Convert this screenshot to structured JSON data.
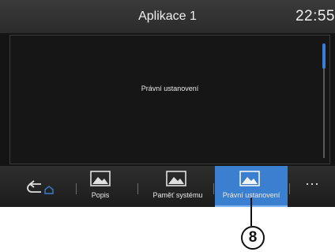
{
  "header": {
    "title": "Aplikace 1",
    "clock": "22:55"
  },
  "content": {
    "text": "Právní ustanovení"
  },
  "tabbar": {
    "back_icon": "back-home-icon",
    "tabs": [
      {
        "label": "Popis",
        "icon": "image-icon",
        "active": false
      },
      {
        "label": "Paměť systému",
        "icon": "image-icon",
        "active": false
      },
      {
        "label": "Právní ustanovení",
        "icon": "image-icon",
        "active": true
      }
    ],
    "more_label": "···"
  },
  "callout": {
    "number": "8"
  },
  "colors": {
    "accent": "#3b7fd0",
    "background": "#141414"
  }
}
